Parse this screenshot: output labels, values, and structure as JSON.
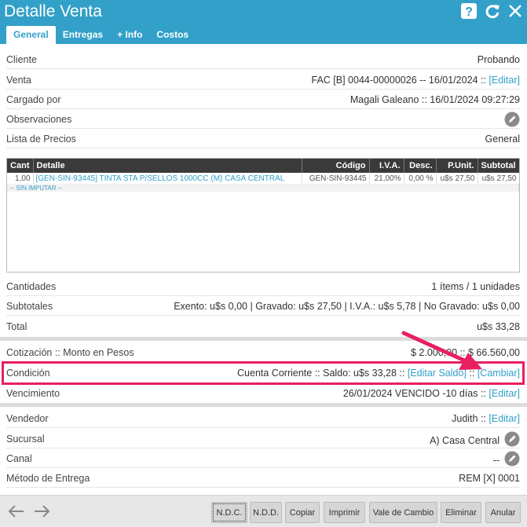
{
  "window": {
    "title": "Detalle Venta"
  },
  "tabs": [
    "General",
    "Entregas",
    "+ Info",
    "Costos"
  ],
  "fields": {
    "cliente": {
      "label": "Cliente",
      "value": "Probando"
    },
    "venta": {
      "label": "Venta",
      "value": "FAC [B] 0044-00000026 -- 16/01/2024 ::",
      "link": "[Editar]"
    },
    "cargado": {
      "label": "Cargado por",
      "value": "Magali Galeano :: 16/01/2024 09:27:29"
    },
    "observaciones": {
      "label": "Observaciones"
    },
    "lista": {
      "label": "Lista de Precios",
      "value": "General"
    },
    "cantidades": {
      "label": "Cantidades",
      "value": "1 ítems / 1 unidades"
    },
    "subtotales": {
      "label": "Subtotales",
      "value": "Exento: u$s 0,00 | Gravado: u$s 27,50 | I.V.A.: u$s 5,78 | No Gravado: u$s 0,00"
    },
    "total": {
      "label": "Total",
      "value": "u$s 33,28"
    },
    "cotizacion": {
      "label": "Cotización :: Monto en Pesos",
      "value": "$ 2.000,00 :: $ 66.560,00"
    },
    "condicion": {
      "label": "Condición",
      "value": "Cuenta Corriente :: Saldo: u$s 33,28 ::",
      "link1": "[Editar Saldo]",
      "sep": "::",
      "link2": "[Cambiar]"
    },
    "vencimiento": {
      "label": "Vencimiento",
      "value": "26/01/2024 VENCIDO -10 días ::",
      "link": "[Editar]"
    },
    "vendedor": {
      "label": "Vendedor",
      "value": "Judith ::",
      "link": "[Editar]"
    },
    "sucursal": {
      "label": "Sucursal",
      "value": "A) Casa Central"
    },
    "canal": {
      "label": "Canal",
      "value": "--"
    },
    "metodo": {
      "label": "Método de Entrega",
      "value": "REM [X] 0001"
    }
  },
  "table": {
    "headers": [
      "Cant",
      "Detalle",
      "Código",
      "I.V.A.",
      "Desc.",
      "P.Unit.",
      "Subtotal"
    ],
    "rows": [
      [
        "1,00",
        "[GEN-SIN-93445] TINTA STA P/SELLOS 1000CC (M) CASA CENTRAL",
        "GEN-SIN-93445",
        "21,00%",
        "0,00 %",
        "u$s 27,50",
        "u$s 27,50"
      ]
    ],
    "sin_imputar": "-- SIN IMPUTAR --"
  },
  "footer": {
    "buttons": [
      "N.D.C.",
      "N.D.D.",
      "Copiar",
      "Imprimir",
      "Vale de Cambio",
      "Eliminar",
      "Anular"
    ]
  },
  "icons": [
    "help-icon",
    "refresh-icon",
    "close-icon",
    "pencil-icon",
    "arrow-left-icon",
    "arrow-right-icon"
  ],
  "colors": {
    "header": "#32a0c8",
    "highlight": "#e8205f",
    "link": "#32a0c8"
  }
}
